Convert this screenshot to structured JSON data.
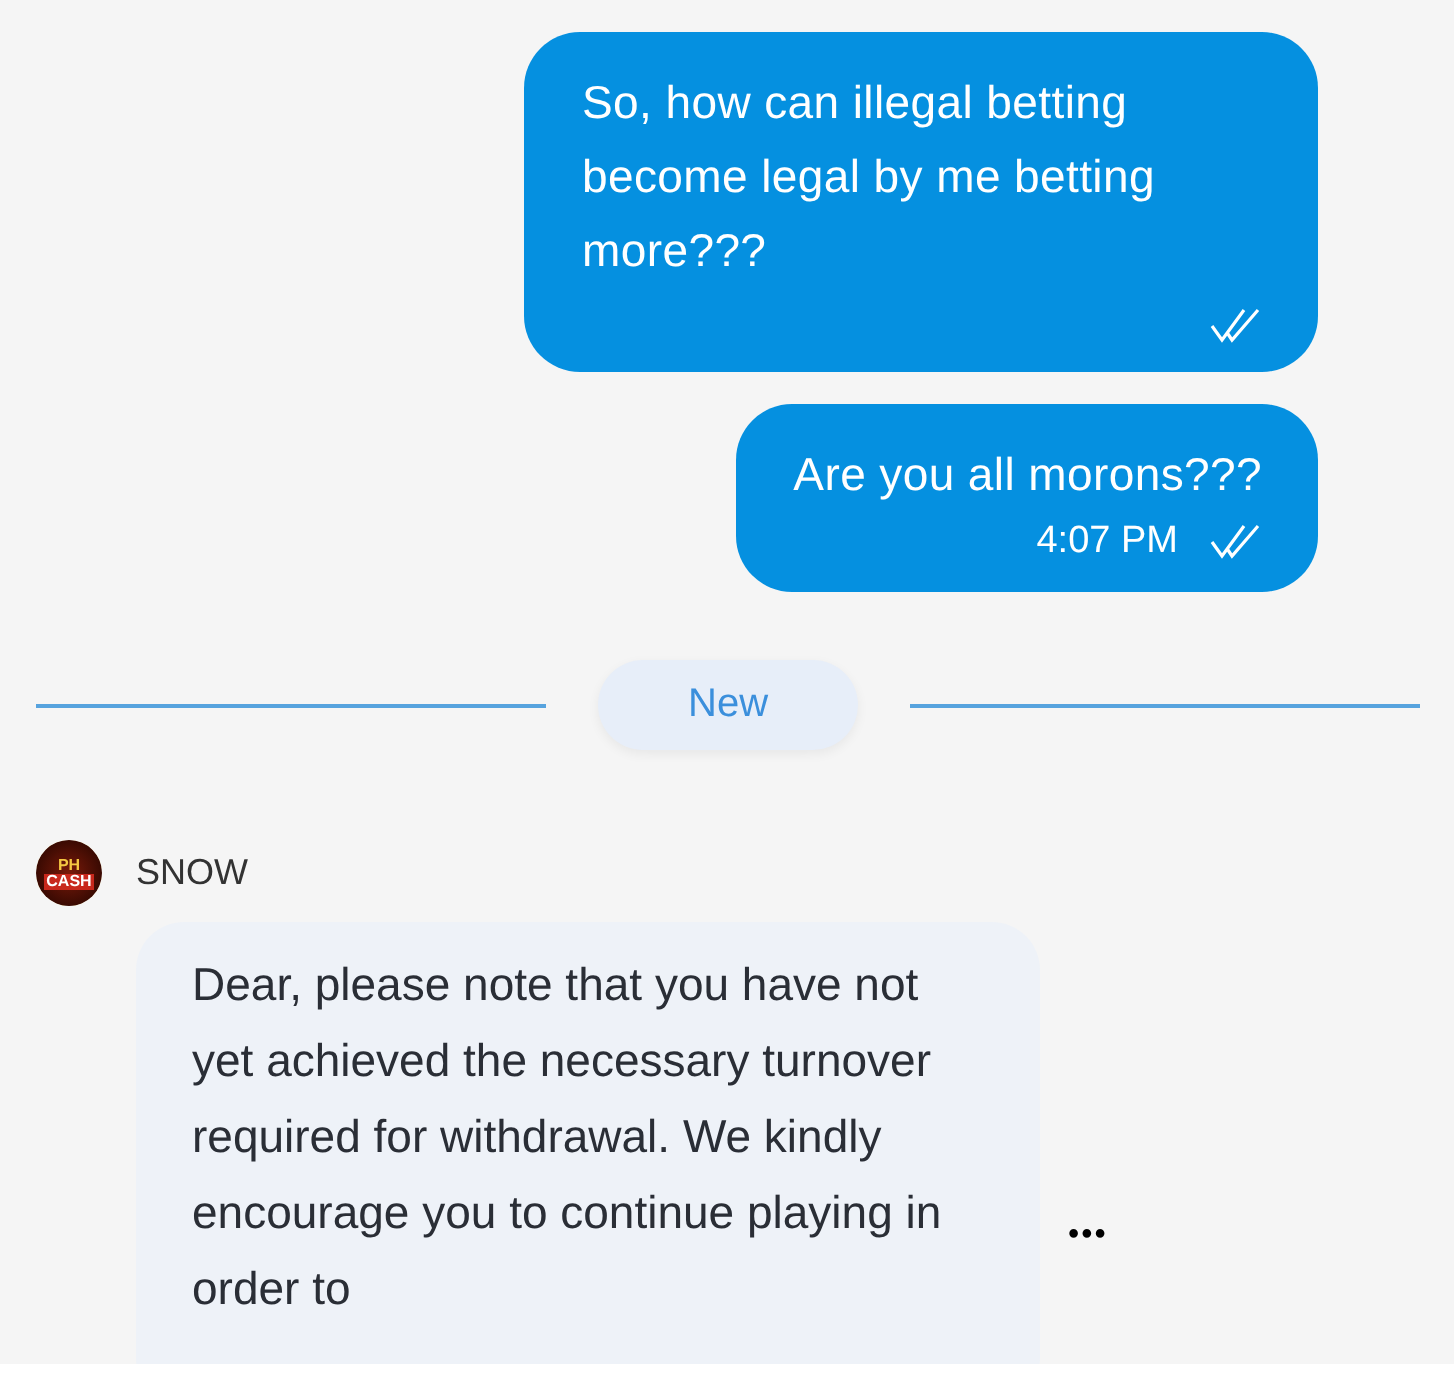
{
  "outgoing_messages": [
    {
      "text": "So, how can illegal betting become legal by me betting more???",
      "read": true
    },
    {
      "text": "Are you all morons???",
      "time": "4:07 PM",
      "read": true
    }
  ],
  "divider": {
    "label": "New"
  },
  "incoming": {
    "sender": "SNOW",
    "avatar_text": [
      "PH",
      "CASH"
    ],
    "text": "Dear, please note that you have not yet achieved the necessary turnover required for withdrawal. We kindly encourage you to continue playing in order to",
    "more": "•••"
  }
}
